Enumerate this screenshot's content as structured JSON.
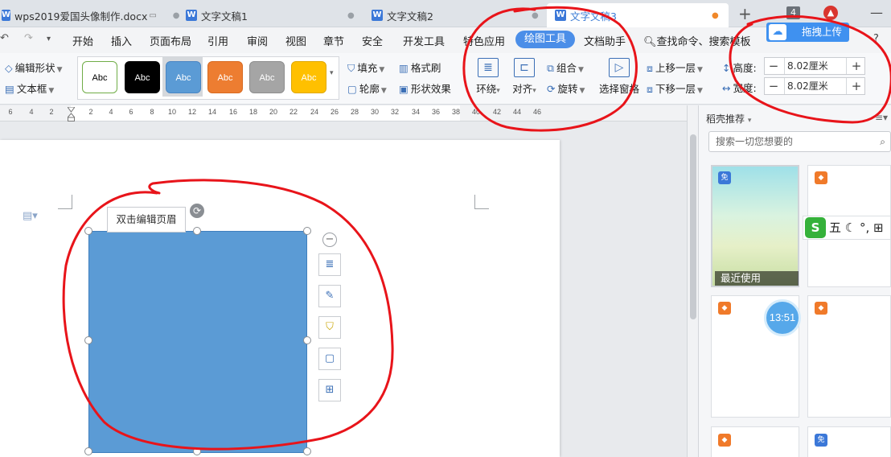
{
  "tabs": [
    {
      "label": "wps2019爱国头像制作.docx",
      "active": false
    },
    {
      "label": "文字文稿1",
      "active": false
    },
    {
      "label": "文字文稿2",
      "active": false
    },
    {
      "label": "文字文稿3",
      "active": true
    }
  ],
  "tab_badge": "4",
  "menu": {
    "items": [
      "开始",
      "插入",
      "页面布局",
      "引用",
      "审阅",
      "视图",
      "章节",
      "安全",
      "开发工具",
      "特色应用",
      "绘图工具",
      "文档助手"
    ],
    "active": "绘图工具",
    "search": "查找命令、搜索模板",
    "cloud_upload": "拖拽上传"
  },
  "ribbon": {
    "edit_shape": "编辑形状",
    "text_box": "文本框",
    "style_swatches": [
      {
        "label": "Abc",
        "fill": "#ffffff",
        "border": "#70ad47",
        "text": "#000000"
      },
      {
        "label": "Abc",
        "fill": "#000000",
        "border": "#000000",
        "text": "#ffffff"
      },
      {
        "label": "Abc",
        "fill": "#5b9bd5",
        "border": "#4a86c4",
        "text": "#ffffff"
      },
      {
        "label": "Abc",
        "fill": "#ed7d31",
        "border": "#d86a20",
        "text": "#ffffff"
      },
      {
        "label": "Abc",
        "fill": "#a5a5a5",
        "border": "#8e8e8e",
        "text": "#ffffff"
      },
      {
        "label": "Abc",
        "fill": "#ffc000",
        "border": "#e0a800",
        "text": "#ffffff"
      }
    ],
    "fill": "填充",
    "format_painter": "格式刷",
    "outline": "轮廓",
    "shape_effect": "形状效果",
    "wrap": "环绕",
    "align": "对齐",
    "group": "组合",
    "rotate": "旋转",
    "selection_pane": "选择窗格",
    "bring_forward": "上移一层",
    "send_backward": "下移一层",
    "height_label": "高度:",
    "height_value": "8.02厘米",
    "width_label": "宽度:",
    "width_value": "8.02厘米"
  },
  "ruler_ticks": [
    "6",
    "4",
    "2",
    "2",
    "4",
    "6",
    "8",
    "10",
    "12",
    "14",
    "16",
    "18",
    "20",
    "22",
    "24",
    "26",
    "28",
    "30",
    "32",
    "34",
    "36",
    "38",
    "40",
    "42",
    "44",
    "46"
  ],
  "document": {
    "header_tip": "双击编辑页眉",
    "shape_fill": "#5b9bd5"
  },
  "panel": {
    "title": "稻壳推荐",
    "search_placeholder": "搜索一切您想要的",
    "recent_label": "最近使用",
    "free_badge": "免",
    "clock": "13:51",
    "ime_chars": "五"
  },
  "accent": "#4b8ee8",
  "annotation_color": "#e8141a"
}
